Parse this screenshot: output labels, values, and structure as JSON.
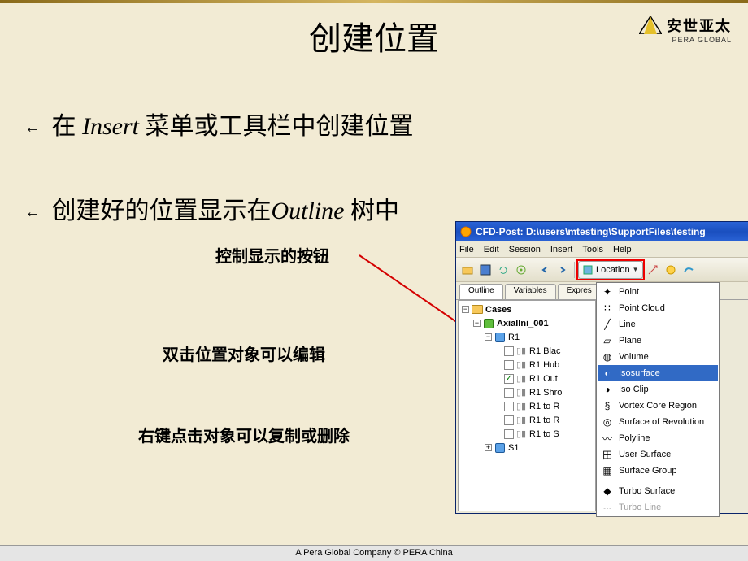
{
  "logo": {
    "cn": "安世亚太",
    "en": "PERA GLOBAL"
  },
  "title": "创建位置",
  "bullet1_pre": "在 ",
  "bullet1_italic": "Insert",
  "bullet1_post": " 菜单或工具栏中创建位置",
  "bullet2_pre": "创建好的位置显示在",
  "bullet2_italic": "Outline",
  "bullet2_post": " 树中",
  "notes": {
    "control": "控制显示的按钮",
    "dblclick": "双击位置对象可以编辑",
    "rightclick": "右键点击对象可以复制或删除"
  },
  "footer": "A Pera Global Company ©  PERA China",
  "cfd": {
    "title_app": "CFD-Post:",
    "title_path": "D:\\users\\mtesting\\SupportFiles\\testing",
    "menu": [
      "File",
      "Edit",
      "Session",
      "Insert",
      "Tools",
      "Help"
    ],
    "toolbar": {
      "location_label": "Location"
    },
    "tabs": [
      "Outline",
      "Variables",
      "Expres"
    ],
    "tree": {
      "root": "Cases",
      "case": "AxialIni_001",
      "domain1": "R1",
      "children1": [
        "R1 Blac",
        "R1 Hub",
        "R1 Out",
        "R1 Shro",
        "R1 to R",
        "R1 to R",
        "R1 to S"
      ],
      "checked_index": 2,
      "domain2": "S1"
    },
    "menu_items": [
      "Point",
      "Point Cloud",
      "Line",
      "Plane",
      "Volume",
      "Isosurface",
      "Iso Clip",
      "Vortex Core Region",
      "Surface of Revolution",
      "Polyline",
      "User Surface",
      "Surface Group",
      "Turbo Surface",
      "Turbo Line"
    ],
    "menu_highlight": 5,
    "menu_disabled": [
      13
    ]
  }
}
